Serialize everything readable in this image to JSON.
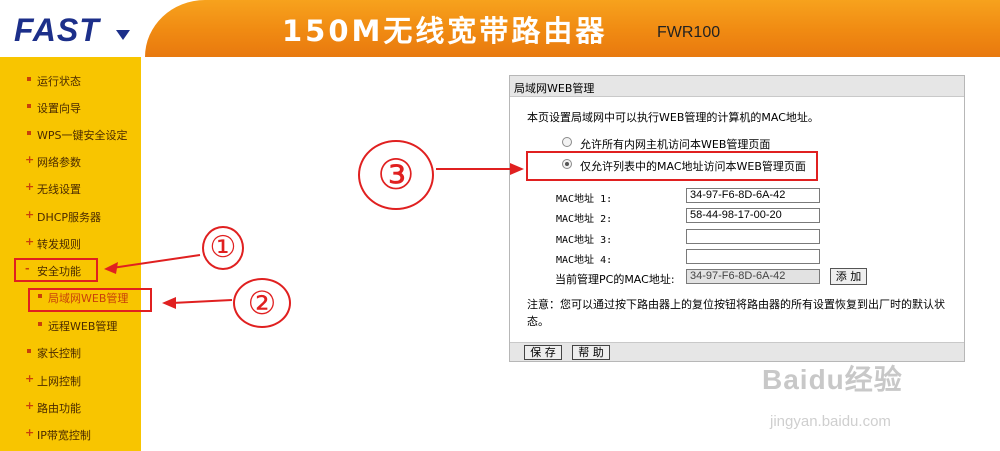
{
  "header": {
    "logo": "FAST",
    "title": "150M无线宽带路由器",
    "model": "FWR100",
    "brand_color": "#1c2f8a",
    "accent_color": "#f08a12"
  },
  "sidebar": {
    "bg_color": "#f8c500",
    "items": [
      {
        "label": "运行状态",
        "marker": "bullet"
      },
      {
        "label": "设置向导",
        "marker": "bullet"
      },
      {
        "label": "WPS一键安全设定",
        "marker": "bullet"
      },
      {
        "label": "网络参数",
        "marker": "+"
      },
      {
        "label": "无线设置",
        "marker": "+"
      },
      {
        "label": "DHCP服务器",
        "marker": "+"
      },
      {
        "label": "转发规则",
        "marker": "+"
      },
      {
        "label": "安全功能",
        "marker": "-"
      },
      {
        "label": "局域网WEB管理",
        "marker": "bullet"
      },
      {
        "label": "远程WEB管理",
        "marker": "bullet"
      },
      {
        "label": "家长控制",
        "marker": "bullet"
      },
      {
        "label": "上网控制",
        "marker": "+"
      },
      {
        "label": "路由功能",
        "marker": "+"
      },
      {
        "label": "IP带宽控制",
        "marker": "+"
      }
    ]
  },
  "panel": {
    "title": "局域网WEB管理",
    "description": "本页设置局域网中可以执行WEB管理的计算机的MAC地址。",
    "radio_all": "允许所有内网主机访问本WEB管理页面",
    "radio_list": "仅允许列表中的MAC地址访问本WEB管理页面",
    "radio_selected": "list",
    "mac_fields": [
      {
        "label": "MAC地址 1:",
        "value": "34-97-F6-8D-6A-42"
      },
      {
        "label": "MAC地址 2:",
        "value": "58-44-98-17-00-20"
      },
      {
        "label": "MAC地址 3:",
        "value": ""
      },
      {
        "label": "MAC地址 4:",
        "value": ""
      }
    ],
    "current_pc_label": "当前管理PC的MAC地址:",
    "current_pc_value": "34-97-F6-8D-6A-42",
    "add_button": "添 加",
    "note": "注意：您可以通过按下路由器上的复位按钮将路由器的所有设置恢复到出厂时的默认状态。",
    "save_button": "保 存",
    "help_button": "帮 助"
  },
  "annotations": {
    "circle_1": "①",
    "circle_2": "②",
    "circle_3": "③",
    "color": "#e02020"
  },
  "watermark": {
    "main": "Baidu经验",
    "sub": "jingyan.baidu.com"
  }
}
